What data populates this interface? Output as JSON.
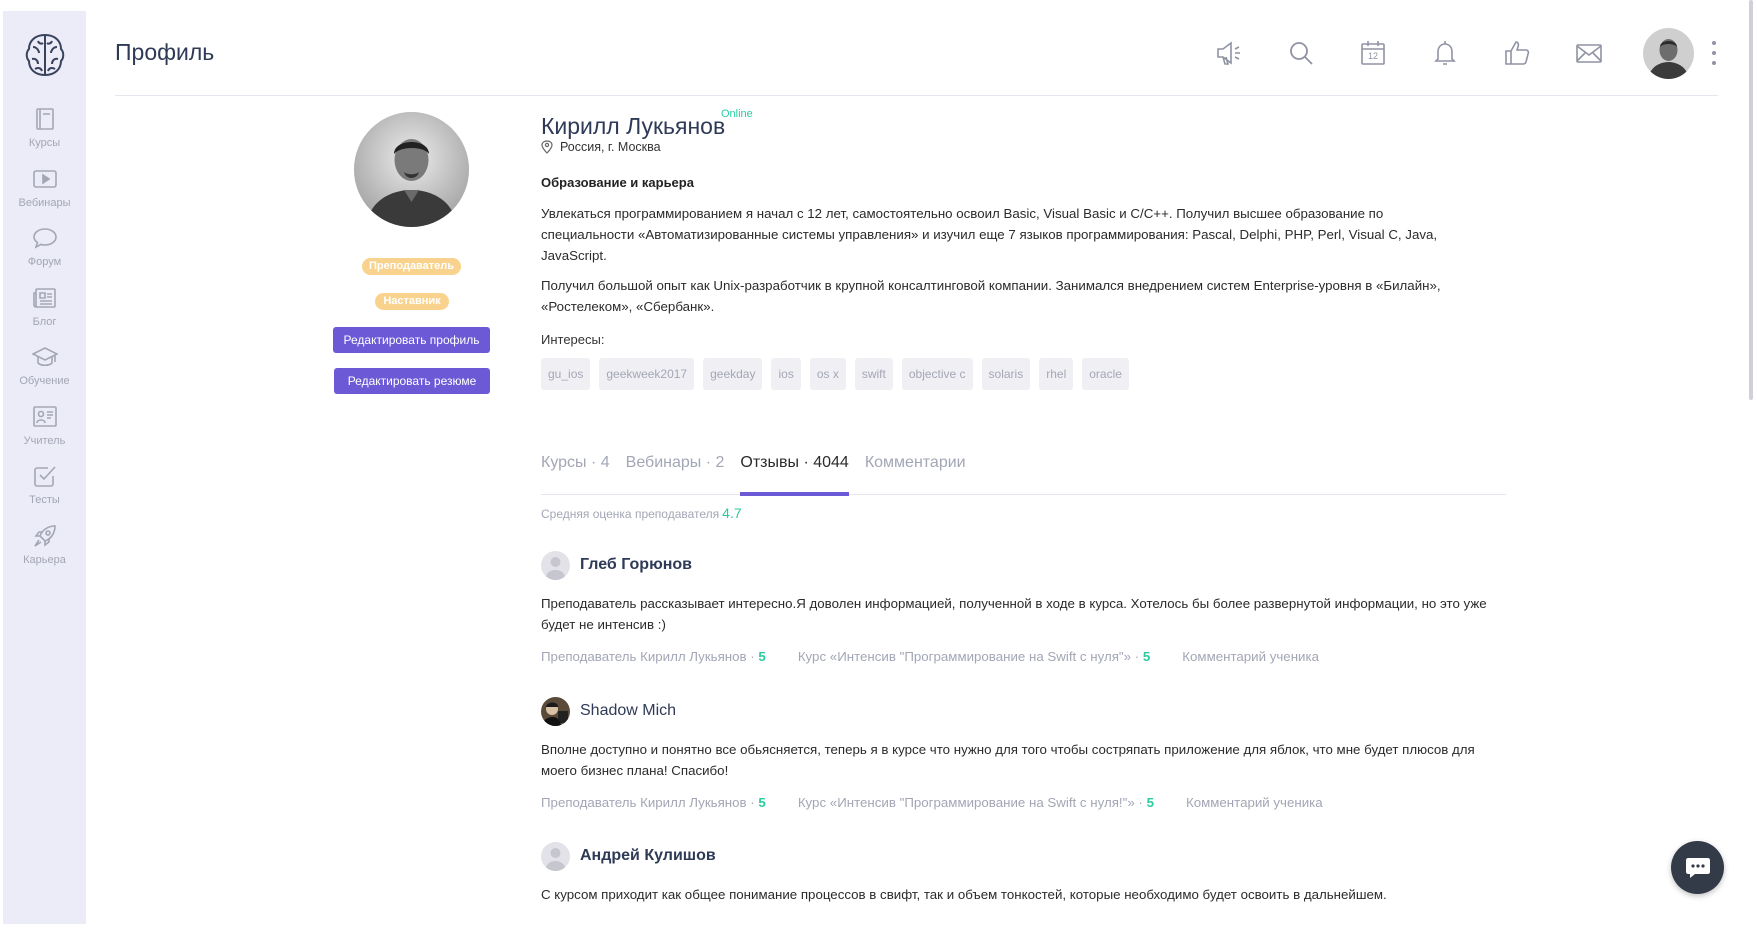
{
  "header": {
    "title": "Профиль"
  },
  "sidebar": {
    "items": [
      {
        "label": "Курсы",
        "icon": "book-icon"
      },
      {
        "label": "Вебинары",
        "icon": "play-icon"
      },
      {
        "label": "Форум",
        "icon": "speech-bubble-icon"
      },
      {
        "label": "Блог",
        "icon": "newspaper-icon"
      },
      {
        "label": "Обучение",
        "icon": "graduation-cap-icon"
      },
      {
        "label": "Учитель",
        "icon": "teacher-icon"
      },
      {
        "label": "Тесты",
        "icon": "checkbox-icon"
      },
      {
        "label": "Карьера",
        "icon": "rocket-icon"
      }
    ]
  },
  "topbar": {
    "icons": [
      "megaphone-icon",
      "search-icon",
      "calendar-icon",
      "bell-icon",
      "thumbs-up-icon",
      "mail-icon"
    ],
    "calendar_day": "12"
  },
  "profile": {
    "name": "Кирилл Лукьянов",
    "status": "Online",
    "location": "Россия, г. Москва",
    "badges": {
      "teacher": "Преподаватель",
      "mentor": "Наставник"
    },
    "buttons": {
      "edit_profile": "Редактировать профиль",
      "edit_resume": "Редактировать резюме"
    },
    "section_title": "Образование и карьера",
    "bio": [
      "Увлекаться программированием я начал с 12 лет, самостоятельно освоил Basic, Visual Basic и C/C++. Получил высшее образование по специальности «Автоматизированные системы управления» и изучил еще 7 языков программирования: Pascal, Delphi, PHP, Perl, Visual C, Java, JavaScript.",
      "Получил большой опыт как Unix-разработчик в крупной консалтинговой компании. Занимался внедрением систем Enterprise-уровня в «Билайн», «Ростелеком», «Сбербанк»."
    ],
    "interests_label": "Интересы:",
    "tags": [
      "gu_ios",
      "geekweek2017",
      "geekday",
      "ios",
      "os x",
      "swift",
      "objective c",
      "solaris",
      "rhel",
      "oracle"
    ]
  },
  "tabs": [
    {
      "label": "Курсы · 4",
      "active": false
    },
    {
      "label": "Вебинары · 2",
      "active": false
    },
    {
      "label": "Отзывы · 4044",
      "active": true
    },
    {
      "label": "Комментарии",
      "active": false
    }
  ],
  "rating": {
    "label": "Средняя оценка преподавателя",
    "value": "4.7"
  },
  "reviews": [
    {
      "author": "Глеб Горюнов",
      "text": "Преподаватель рассказывает интересно.Я доволен информацией, полученной в ходе в курса. Хотелось бы более развернутой информации, но это уже будет не интенсив :)",
      "teacher_label": "Преподаватель Кирилл Лукьянов ·",
      "teacher_score": "5",
      "course_label": "Курс «Интенсив \"Программирование на Swift с нуля\"» ·",
      "course_score": "5",
      "comment_label": "Комментарий ученика"
    },
    {
      "author": "Shadow Mich",
      "text": "Вполне доступно и понятно все обьясняется, теперь я в курсе что нужно для того чтобы состряпать приложение для яблок, что мне будет плюсов для моего бизнес плана! Спасибо!",
      "teacher_label": "Преподаватель Кирилл Лукьянов ·",
      "teacher_score": "5",
      "course_label": "Курс «Интенсив \"Программирование на Swift с нуля!\"» ·",
      "course_score": "5",
      "comment_label": "Комментарий ученика"
    },
    {
      "author": "Андрей Кулишов",
      "text": "С курсом приходит как общее понимание процессов в свифт, так и объем тонкостей, которые необходимо будет освоить в дальнейшем."
    }
  ],
  "colors": {
    "accent": "#6b59d6",
    "green": "#2ccaa0",
    "badge": "#f9d38e",
    "sidebar_bg": "#ececf8"
  }
}
